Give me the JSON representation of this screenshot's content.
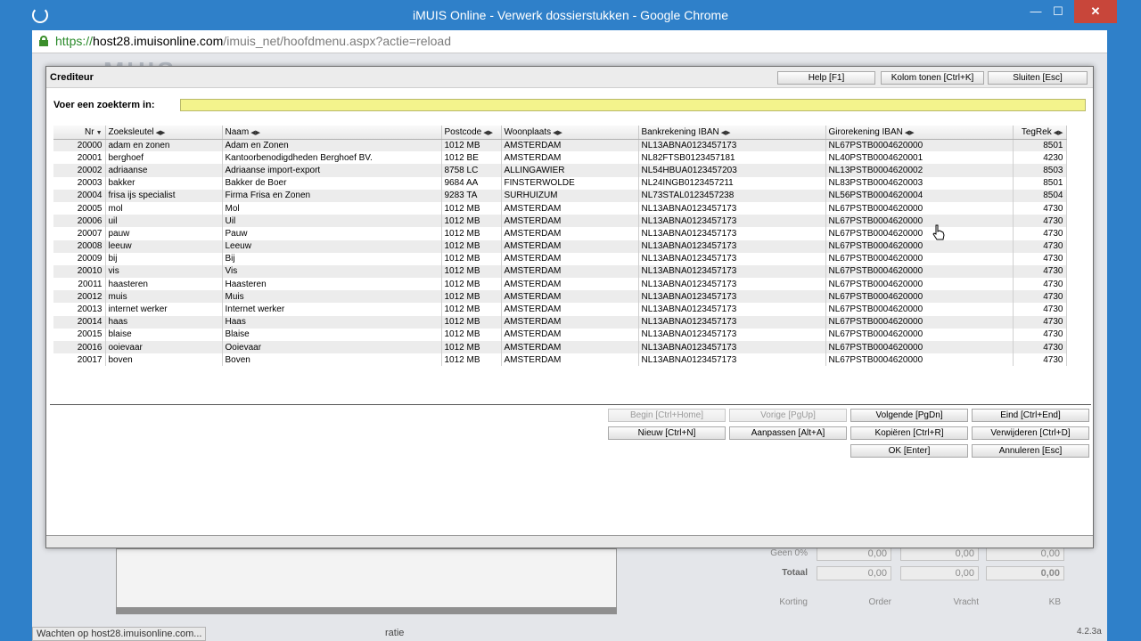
{
  "window": {
    "title": "iMUIS Online - Verwerk dossierstukken - Google Chrome",
    "url_proto": "https://",
    "url_host": "host28.imuisonline.com",
    "url_path": "/imuis_net/hoofdmenu.aspx?actie=reload",
    "min_label": "—",
    "max_label": "☐",
    "close_label": "✕"
  },
  "dialog": {
    "title": "Crediteur",
    "header_buttons": {
      "help": "Help [F1]",
      "columns": "Kolom tonen [Ctrl+K]",
      "close": "Sluiten [Esc]"
    },
    "search": {
      "label": "Voer een zoekterm in:",
      "value": ""
    },
    "columns": [
      "Nr",
      "Zoeksleutel",
      "Naam",
      "Postcode",
      "Woonplaats",
      "Bankrekening IBAN",
      "Girorekening IBAN",
      "TegRek"
    ],
    "rows": [
      [
        "20000",
        "adam en zonen",
        "Adam en Zonen",
        "1012 MB",
        "AMSTERDAM",
        "NL13ABNA0123457173",
        "NL67PSTB0004620000",
        "8501"
      ],
      [
        "20001",
        "berghoef",
        "Kantoorbenodigdheden Berghoef BV.",
        "1012 BE",
        "AMSTERDAM",
        "NL82FTSB0123457181",
        "NL40PSTB0004620001",
        "4230"
      ],
      [
        "20002",
        "adriaanse",
        "Adriaanse import-export",
        "8758 LC",
        "ALLINGAWIER",
        "NL54HBUA0123457203",
        "NL13PSTB0004620002",
        "8503"
      ],
      [
        "20003",
        "bakker",
        "Bakker de Boer",
        "9684 AA",
        "FINSTERWOLDE",
        "NL24INGB0123457211",
        "NL83PSTB0004620003",
        "8501"
      ],
      [
        "20004",
        "frisa ijs specialist",
        "Firma Frisa en Zonen",
        "9283 TA",
        "SURHUIZUM",
        "NL73STAL0123457238",
        "NL56PSTB0004620004",
        "8504"
      ],
      [
        "20005",
        "mol",
        "Mol",
        "1012 MB",
        "AMSTERDAM",
        "NL13ABNA0123457173",
        "NL67PSTB0004620000",
        "4730"
      ],
      [
        "20006",
        "uil",
        "Uil",
        "1012 MB",
        "AMSTERDAM",
        "NL13ABNA0123457173",
        "NL67PSTB0004620000",
        "4730"
      ],
      [
        "20007",
        "pauw",
        "Pauw",
        "1012 MB",
        "AMSTERDAM",
        "NL13ABNA0123457173",
        "NL67PSTB0004620000",
        "4730"
      ],
      [
        "20008",
        "leeuw",
        "Leeuw",
        "1012 MB",
        "AMSTERDAM",
        "NL13ABNA0123457173",
        "NL67PSTB0004620000",
        "4730"
      ],
      [
        "20009",
        "bij",
        "Bij",
        "1012 MB",
        "AMSTERDAM",
        "NL13ABNA0123457173",
        "NL67PSTB0004620000",
        "4730"
      ],
      [
        "20010",
        "vis",
        "Vis",
        "1012 MB",
        "AMSTERDAM",
        "NL13ABNA0123457173",
        "NL67PSTB0004620000",
        "4730"
      ],
      [
        "20011",
        "haasteren",
        "Haasteren",
        "1012 MB",
        "AMSTERDAM",
        "NL13ABNA0123457173",
        "NL67PSTB0004620000",
        "4730"
      ],
      [
        "20012",
        "muis",
        "Muis",
        "1012 MB",
        "AMSTERDAM",
        "NL13ABNA0123457173",
        "NL67PSTB0004620000",
        "4730"
      ],
      [
        "20013",
        "internet werker",
        "Internet werker",
        "1012 MB",
        "AMSTERDAM",
        "NL13ABNA0123457173",
        "NL67PSTB0004620000",
        "4730"
      ],
      [
        "20014",
        "haas",
        "Haas",
        "1012 MB",
        "AMSTERDAM",
        "NL13ABNA0123457173",
        "NL67PSTB0004620000",
        "4730"
      ],
      [
        "20015",
        "blaise",
        "Blaise",
        "1012 MB",
        "AMSTERDAM",
        "NL13ABNA0123457173",
        "NL67PSTB0004620000",
        "4730"
      ],
      [
        "20016",
        "ooievaar",
        "Ooievaar",
        "1012 MB",
        "AMSTERDAM",
        "NL13ABNA0123457173",
        "NL67PSTB0004620000",
        "4730"
      ],
      [
        "20017",
        "boven",
        "Boven",
        "1012 MB",
        "AMSTERDAM",
        "NL13ABNA0123457173",
        "NL67PSTB0004620000",
        "4730"
      ]
    ],
    "buttons": {
      "begin": "Begin [Ctrl+Home]",
      "prev": "Vorige [PgUp]",
      "next": "Volgende [PgDn]",
      "end": "Eind [Ctrl+End]",
      "new": "Nieuw [Ctrl+N]",
      "edit": "Aanpassen [Alt+A]",
      "copy": "Kopiëren [Ctrl+R]",
      "delete": "Verwijderen [Ctrl+D]",
      "ok": "OK [Enter]",
      "cancel": "Annuleren [Esc]"
    }
  },
  "background": {
    "logo": "MUIS",
    "labels": {
      "geen": "Geen 0%",
      "totaal": "Totaal",
      "korting": "Korting",
      "order": "Order",
      "vracht": "Vracht",
      "kb": "KB",
      "ratie": "ratie"
    },
    "values": {
      "zero": "0,00"
    }
  },
  "status": {
    "text": "Wachten op host28.imuisonline.com...",
    "version": "4.2.3a"
  },
  "colors": {
    "chrome_blue": "#2f80c9",
    "search_yellow": "#f3f38c"
  }
}
